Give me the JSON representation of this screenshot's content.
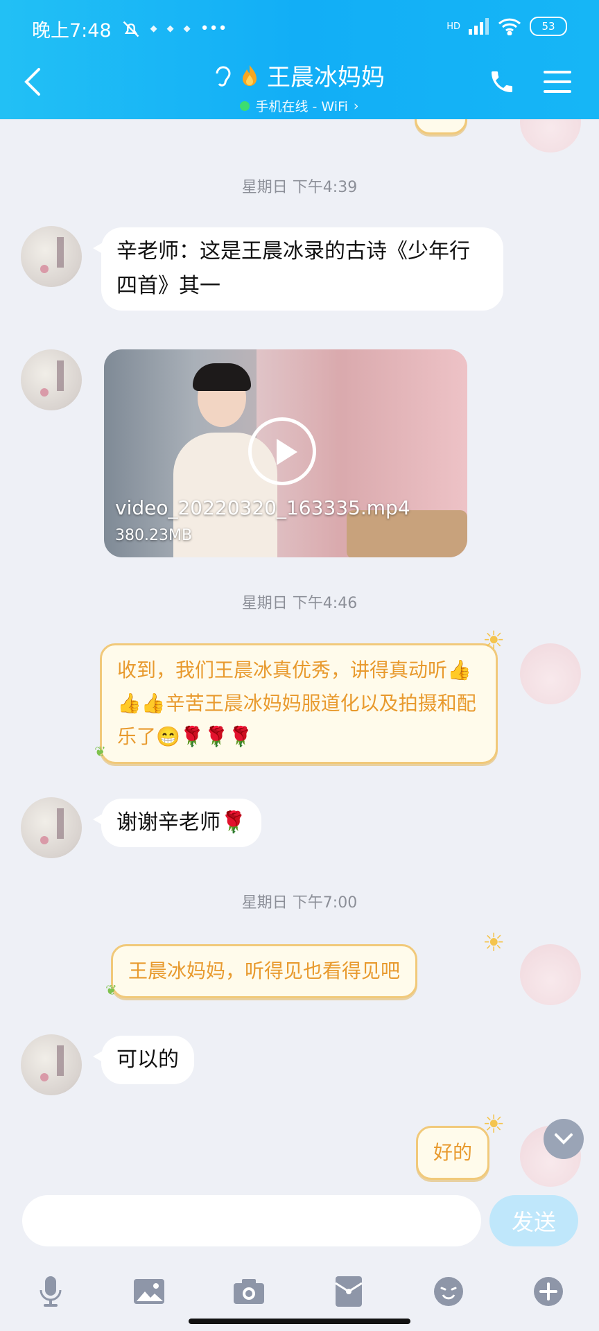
{
  "status_bar": {
    "time": "晚上7:48",
    "icons": [
      "bell-off-icon",
      "app-icon",
      "app-icon",
      "app-icon",
      "more-dots-icon"
    ],
    "network": "HD",
    "battery": "53"
  },
  "header": {
    "title": "王晨冰妈妈",
    "subtitle": "手机在线 - WiFi",
    "colors": {
      "bg": "#18b6f6",
      "online": "#3fe06a"
    }
  },
  "messages": {
    "ts1": "星期日 下午4:39",
    "m1": "辛老师：这是王晨冰录的古诗《少年行四首》其一",
    "video_name": "video_20220320_163335.mp4",
    "video_size": "380.23MB",
    "ts2": "星期日 下午4:46",
    "m2": "收到，我们王晨冰真优秀，讲得真动听👍👍👍辛苦王晨冰妈妈服道化以及拍摄和配乐了😁🌹🌹🌹",
    "m3": "谢谢辛老师🌹",
    "ts3": "星期日 下午7:00",
    "m4": "王晨冰妈妈，听得见也看得见吧",
    "m5": "可以的",
    "m6": "好的"
  },
  "input": {
    "send_label": "发送",
    "placeholder": ""
  },
  "toolbar": [
    "mic-icon",
    "image-icon",
    "camera-icon",
    "red-packet-icon",
    "emoji-icon",
    "plus-icon"
  ]
}
